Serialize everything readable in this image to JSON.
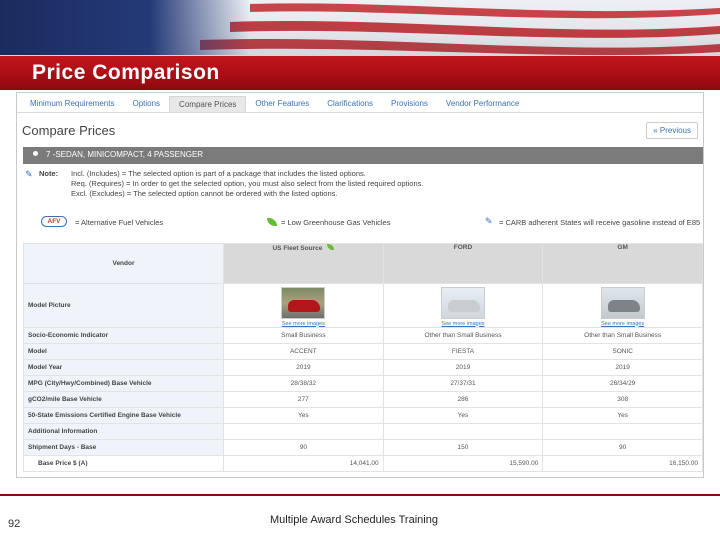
{
  "slide": {
    "title": "Price Comparison",
    "page_number": "92",
    "footer": "Multiple Award Schedules Training"
  },
  "tabs": [
    {
      "label": "Minimum Requirements",
      "active": false
    },
    {
      "label": "Options",
      "active": false
    },
    {
      "label": "Compare Prices",
      "active": true
    },
    {
      "label": "Other Features",
      "active": false
    },
    {
      "label": "Clarifications",
      "active": false
    },
    {
      "label": "Provisions",
      "active": false
    },
    {
      "label": "Vendor Performance",
      "active": false
    }
  ],
  "page": {
    "heading": "Compare Prices",
    "previous_label": "« Previous",
    "category": "7 -SEDAN, MINICOMPACT, 4 PASSENGER"
  },
  "note": {
    "label": "Note:",
    "lines": [
      "Incl. (Includes) = The selected option is part of a package that includes the listed options.",
      "Req. (Requires) = In order to get the selected option, you must also select from the listed required options.",
      "Excl. (Excludes) = The selected option cannot be ordered with the listed options."
    ]
  },
  "legend": {
    "afv_badge": "AFV",
    "afv_text": "= Alternative Fuel Vehicles",
    "leaf_text": "= Low Greenhouse Gas Vehicles",
    "carb_text": "= CARB adherent States will receive gasoline instead of E85"
  },
  "table": {
    "vendor_label": "Vendor",
    "vendors": [
      "US Fleet Source",
      "FORD",
      "GM"
    ],
    "model_picture_label": "Model Picture",
    "see_images": "See more images",
    "rows": [
      {
        "label": "Socio-Economic Indicator",
        "values": [
          "Small Business",
          "Other than Small Business",
          "Other than Small Business"
        ]
      },
      {
        "label": "Model",
        "values": [
          "ACCENT",
          "FIESTA",
          "SONIC"
        ]
      },
      {
        "label": "Model Year",
        "values": [
          "2019",
          "2019",
          "2019"
        ]
      },
      {
        "label": "MPG (City/Hwy/Combined) Base Vehicle",
        "values": [
          "28/38/32",
          "27/37/31",
          "26/34/29"
        ]
      },
      {
        "label": "gCO2/mile Base Vehicle",
        "values": [
          "277",
          "286",
          "308"
        ]
      },
      {
        "label": "50-State Emissions Certified Engine Base Vehicle",
        "values": [
          "Yes",
          "Yes",
          "Yes"
        ]
      },
      {
        "label": "Additional Information",
        "values": [
          "",
          "",
          ""
        ]
      },
      {
        "label": "Shipment Days - Base",
        "values": [
          "90",
          "150",
          "90"
        ]
      }
    ],
    "base_price_label": "Base Price $ (A)",
    "base_prices": [
      "14,041.00",
      "15,590.00",
      "16,150.00"
    ]
  },
  "colors": {
    "title_bar": "#a80d14",
    "link": "#3a72b5",
    "category_bar": "#7b7b7b",
    "label_bg": "#eef4fa"
  }
}
